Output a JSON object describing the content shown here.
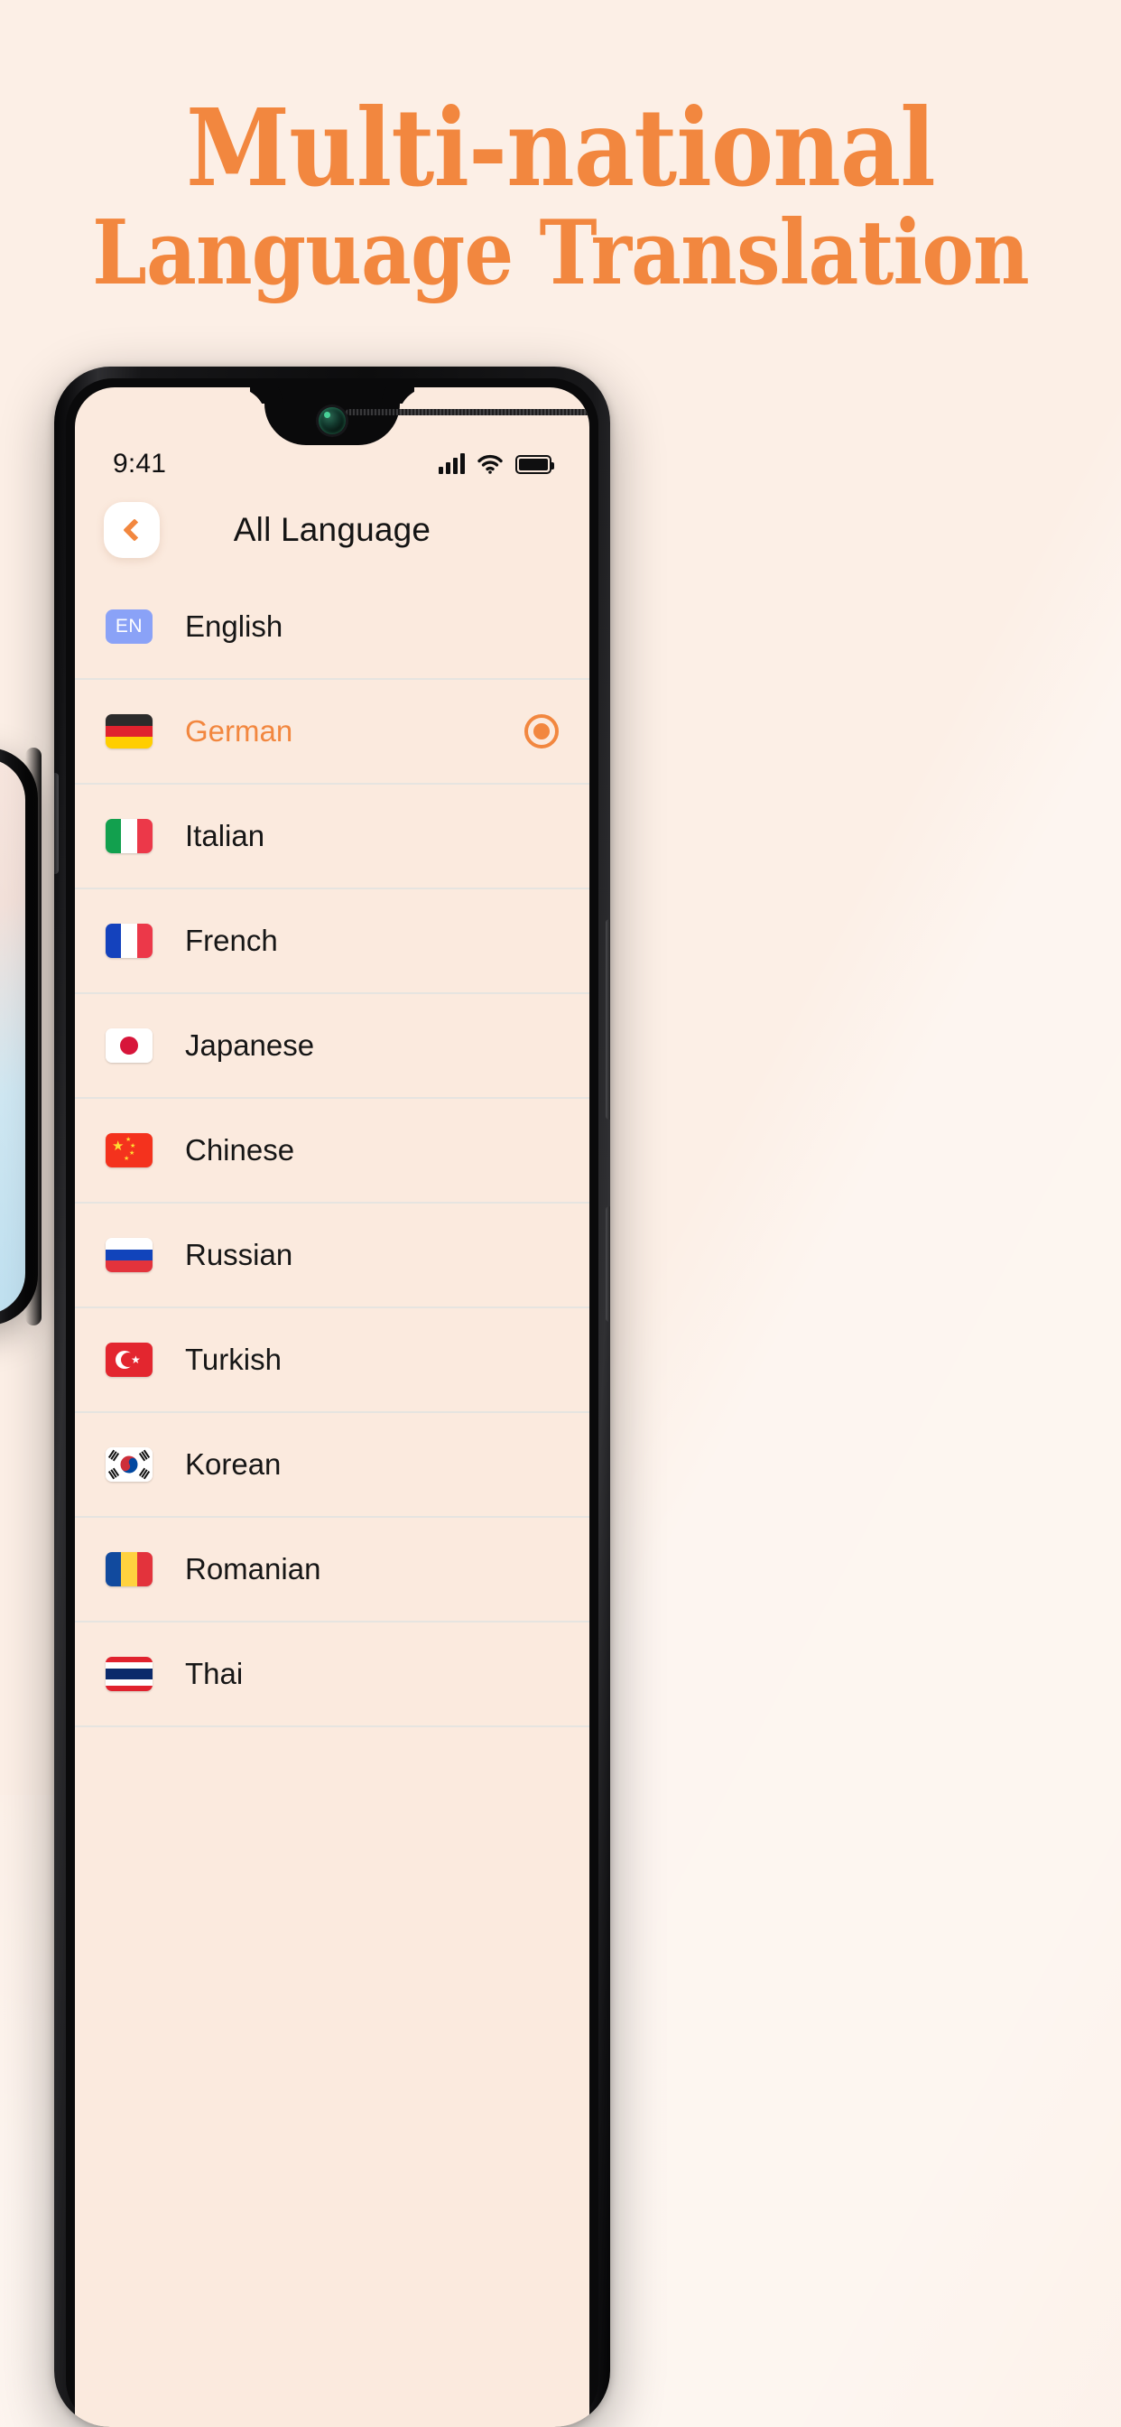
{
  "poster": {
    "headline_line1": "Multi-national",
    "headline_line2": "Language  Translation",
    "accent_color": "#f2873f",
    "background_color": "#fcefe6"
  },
  "phone": {
    "status_bar": {
      "time": "9:41",
      "signal_icon": "cellular-signal-icon",
      "wifi_icon": "wifi-icon",
      "battery_icon": "battery-full-icon"
    },
    "header": {
      "back_icon": "chevron-left-icon",
      "title": "All Language"
    },
    "screen_background": "#fbeade",
    "selected_language": "German",
    "languages": [
      {
        "name": "English",
        "flag": "flag-en-badge",
        "badge_text": "EN",
        "selected": false
      },
      {
        "name": "German",
        "flag": "flag-germany",
        "badge_text": "",
        "selected": true
      },
      {
        "name": "Italian",
        "flag": "flag-italy",
        "badge_text": "",
        "selected": false
      },
      {
        "name": "French",
        "flag": "flag-france",
        "badge_text": "",
        "selected": false
      },
      {
        "name": "Japanese",
        "flag": "flag-japan",
        "badge_text": "",
        "selected": false
      },
      {
        "name": "Chinese",
        "flag": "flag-china",
        "badge_text": "",
        "selected": false
      },
      {
        "name": "Russian",
        "flag": "flag-russia",
        "badge_text": "",
        "selected": false
      },
      {
        "name": "Turkish",
        "flag": "flag-turkey",
        "badge_text": "",
        "selected": false
      },
      {
        "name": "Korean",
        "flag": "flag-korea",
        "badge_text": "",
        "selected": false
      },
      {
        "name": "Romanian",
        "flag": "flag-romania",
        "badge_text": "",
        "selected": false
      },
      {
        "name": "Thai",
        "flag": "flag-thailand",
        "badge_text": "",
        "selected": false
      }
    ]
  },
  "secondary_phone": {
    "visible": true,
    "screen_tint": "#bfe0f0"
  }
}
